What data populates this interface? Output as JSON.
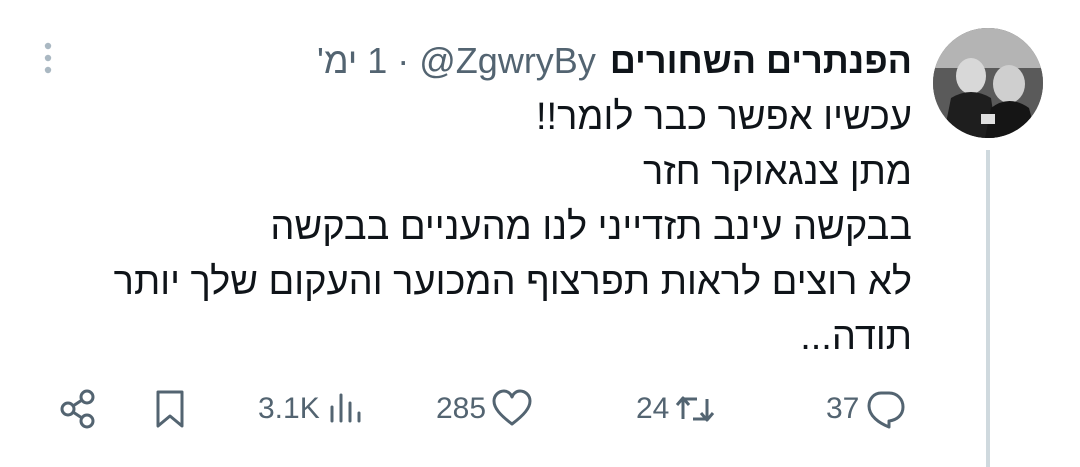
{
  "author": {
    "display_name": "הפנתרים השחורים",
    "handle": "@ZgwryBy",
    "separator": "·",
    "time": "1 ימ'"
  },
  "tweet": {
    "lines": [
      "עכשיו אפשר כבר לומר!!",
      "מתן צנגאוקר חזר",
      "בבקשה עינב תזדייני לנו מהעניים בבקשה",
      "לא רוצים לראות תפרצוף המכוער והעקום שלך יותר",
      "תודה..."
    ]
  },
  "actions": {
    "replies": "37",
    "retweets": "24",
    "likes": "285",
    "views": "3.1K"
  },
  "colors": {
    "text": "#0f1419",
    "muted": "#536471",
    "thread_line": "#cfd9de"
  },
  "icons": {
    "more": "more-vertical-icon",
    "reply": "reply-icon",
    "retweet": "retweet-icon",
    "like": "heart-icon",
    "views": "views-chart-icon",
    "bookmark": "bookmark-icon",
    "share": "share-icon"
  }
}
